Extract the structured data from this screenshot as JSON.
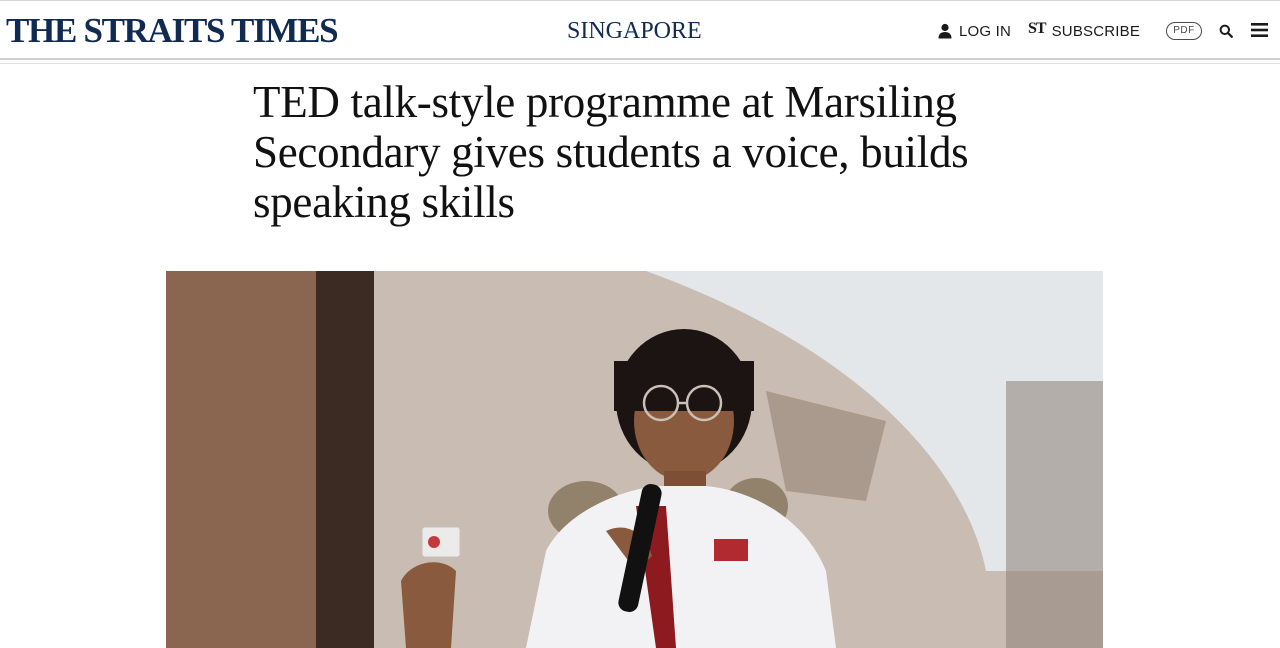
{
  "header": {
    "masthead": "THE STRAITS TIMES",
    "section": "SINGAPORE",
    "login_label": "LOG IN",
    "subscribe_label": "SUBSCRIBE",
    "st_logo": "ST",
    "pdf_label": "PDF"
  },
  "icons": {
    "user": "user-icon",
    "search": "search-icon",
    "menu": "hamburger-menu-icon"
  },
  "article": {
    "headline": "TED talk-style programme at Marsiling Secondary gives students a voice, builds speaking skills"
  },
  "colors": {
    "brand_navy": "#102a52",
    "text": "#111111",
    "rule": "#cfcfcf"
  }
}
